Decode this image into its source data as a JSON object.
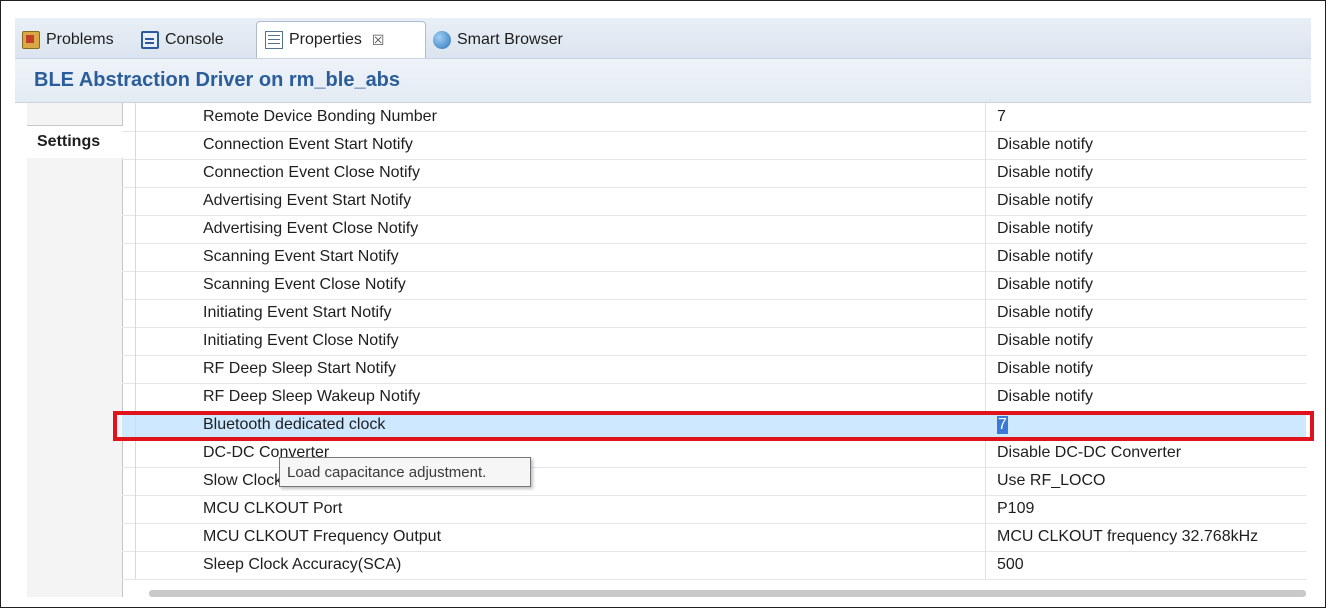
{
  "tabs": [
    {
      "label": "Problems",
      "icon": "problems-icon"
    },
    {
      "label": "Console",
      "icon": "console-icon"
    },
    {
      "label": "Properties",
      "icon": "properties-icon",
      "active": true,
      "close": "☒"
    },
    {
      "label": "Smart Browser",
      "icon": "smart-browser-icon"
    }
  ],
  "header": {
    "title": "BLE Abstraction Driver on rm_ble_abs"
  },
  "left_tabs": {
    "settings": "Settings"
  },
  "properties": [
    {
      "name": "Remote Device Bonding Number",
      "value": "7"
    },
    {
      "name": "Connection Event Start Notify",
      "value": "Disable notify"
    },
    {
      "name": "Connection Event Close Notify",
      "value": "Disable notify"
    },
    {
      "name": "Advertising Event Start Notify",
      "value": "Disable notify"
    },
    {
      "name": "Advertising Event Close Notify",
      "value": "Disable notify"
    },
    {
      "name": "Scanning Event Start Notify",
      "value": "Disable notify"
    },
    {
      "name": "Scanning Event Close Notify",
      "value": "Disable notify"
    },
    {
      "name": "Initiating Event Start Notify",
      "value": "Disable notify"
    },
    {
      "name": "Initiating Event Close Notify",
      "value": "Disable notify"
    },
    {
      "name": "RF Deep Sleep Start Notify",
      "value": "Disable notify"
    },
    {
      "name": "RF Deep Sleep Wakeup Notify",
      "value": "Disable notify"
    },
    {
      "name": "Bluetooth dedicated clock",
      "value": "7",
      "selected": true,
      "editing": true
    },
    {
      "name": "DC-DC Converter",
      "value": "Disable DC-DC Converter"
    },
    {
      "name": "Slow Clock Source",
      "value": "Use RF_LOCO"
    },
    {
      "name": "MCU CLKOUT Port",
      "value": "P109"
    },
    {
      "name": "MCU CLKOUT Frequency Output",
      "value": "MCU CLKOUT frequency 32.768kHz"
    },
    {
      "name": "Sleep Clock Accuracy(SCA)",
      "value": "500"
    }
  ],
  "tooltip": {
    "text": "Load capacitance adjustment."
  },
  "colors": {
    "accent_title": "#2a5d9a",
    "selection": "#cde8ff",
    "highlight_box": "#e0121b"
  }
}
